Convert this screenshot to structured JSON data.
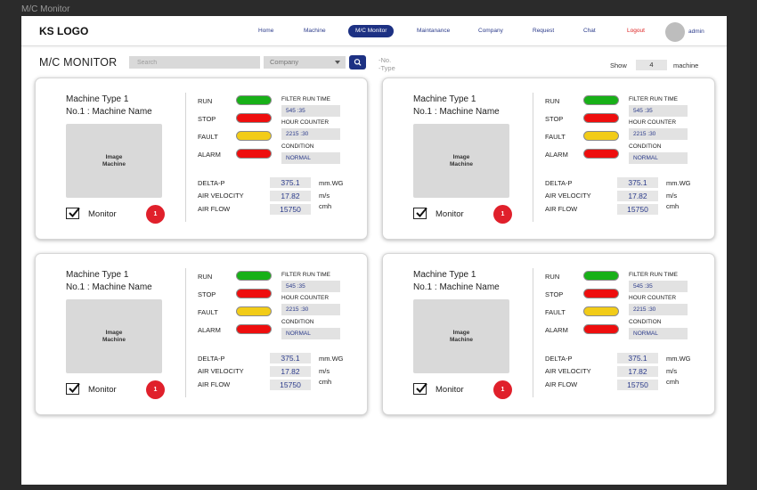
{
  "window_title": "M/C Monitor",
  "navbar": {
    "logo": "KS LOGO",
    "items": [
      {
        "label": "Home"
      },
      {
        "label": "Machine"
      },
      {
        "label": "M/C Monitor"
      },
      {
        "label": "Maintanance"
      },
      {
        "label": "Company"
      },
      {
        "label": "Request"
      },
      {
        "label": "Chat"
      },
      {
        "label": "Logout"
      }
    ],
    "user": "admin"
  },
  "toolbar": {
    "title": "M/C MONITOR",
    "search_placeholder": "Search",
    "company_select": "Company",
    "note_line1": "-No.",
    "note_line2": "-Type",
    "show_label": "Show",
    "show_count": "4",
    "show_unit": "machine"
  },
  "cards": [
    {
      "type": "Machine Type 1",
      "name": "No.1 : Machine Name",
      "image_line1": "Image",
      "image_line2": "Machine",
      "monitor_label": "Monitor",
      "monitor_checked": true,
      "alert_count": "1",
      "statuses": [
        {
          "label": "RUN",
          "color": "#18b018"
        },
        {
          "label": "STOP",
          "color": "#ee0e0e"
        },
        {
          "label": "FAULT",
          "color": "#f2cc18"
        },
        {
          "label": "ALARM",
          "color": "#ee0e0e"
        }
      ],
      "filter_run_time_label": "FILTER RUN TIME",
      "filter_run_time": "545 :35",
      "hour_counter_label": "HOUR COUNTER",
      "hour_counter": "2215 :30",
      "condition_label": "CONDITION",
      "condition": "NORMAL",
      "metrics": [
        {
          "label": "DELTA-P",
          "value": "375.1",
          "unit": "mm.WG"
        },
        {
          "label": "AIR VELOCITY",
          "value": "17.82",
          "unit": "m/s"
        },
        {
          "label": "AIR FLOW",
          "value": "15750",
          "unit": "cmh"
        }
      ]
    },
    {
      "type": "Machine Type 1",
      "name": "No.1 : Machine Name",
      "image_line1": "Image",
      "image_line2": "Machine",
      "monitor_label": "Monitor",
      "monitor_checked": true,
      "alert_count": "1",
      "statuses": [
        {
          "label": "RUN",
          "color": "#18b018"
        },
        {
          "label": "STOP",
          "color": "#ee0e0e"
        },
        {
          "label": "FAULT",
          "color": "#f2cc18"
        },
        {
          "label": "ALARM",
          "color": "#ee0e0e"
        }
      ],
      "filter_run_time_label": "FILTER RUN TIME",
      "filter_run_time": "545 :35",
      "hour_counter_label": "HOUR COUNTER",
      "hour_counter": "2215 :30",
      "condition_label": "CONDITION",
      "condition": "NORMAL",
      "metrics": [
        {
          "label": "DELTA-P",
          "value": "375.1",
          "unit": "mm.WG"
        },
        {
          "label": "AIR VELOCITY",
          "value": "17.82",
          "unit": "m/s"
        },
        {
          "label": "AIR FLOW",
          "value": "15750",
          "unit": "cmh"
        }
      ]
    },
    {
      "type": "Machine Type 1",
      "name": "No.1 : Machine Name",
      "image_line1": "Image",
      "image_line2": "Machine",
      "monitor_label": "Monitor",
      "monitor_checked": true,
      "alert_count": "1",
      "statuses": [
        {
          "label": "RUN",
          "color": "#18b018"
        },
        {
          "label": "STOP",
          "color": "#ee0e0e"
        },
        {
          "label": "FAULT",
          "color": "#f2cc18"
        },
        {
          "label": "ALARM",
          "color": "#ee0e0e"
        }
      ],
      "filter_run_time_label": "FILTER RUN TIME",
      "filter_run_time": "545 :35",
      "hour_counter_label": "HOUR COUNTER",
      "hour_counter": "2215 :30",
      "condition_label": "CONDITION",
      "condition": "NORMAL",
      "metrics": [
        {
          "label": "DELTA-P",
          "value": "375.1",
          "unit": "mm.WG"
        },
        {
          "label": "AIR VELOCITY",
          "value": "17.82",
          "unit": "m/s"
        },
        {
          "label": "AIR FLOW",
          "value": "15750",
          "unit": "cmh"
        }
      ]
    },
    {
      "type": "Machine Type 1",
      "name": "No.1 : Machine Name",
      "image_line1": "Image",
      "image_line2": "Machine",
      "monitor_label": "Monitor",
      "monitor_checked": true,
      "alert_count": "1",
      "statuses": [
        {
          "label": "RUN",
          "color": "#18b018"
        },
        {
          "label": "STOP",
          "color": "#ee0e0e"
        },
        {
          "label": "FAULT",
          "color": "#f2cc18"
        },
        {
          "label": "ALARM",
          "color": "#ee0e0e"
        }
      ],
      "filter_run_time_label": "FILTER RUN TIME",
      "filter_run_time": "545 :35",
      "hour_counter_label": "HOUR COUNTER",
      "hour_counter": "2215 :30",
      "condition_label": "CONDITION",
      "condition": "NORMAL",
      "metrics": [
        {
          "label": "DELTA-P",
          "value": "375.1",
          "unit": "mm.WG"
        },
        {
          "label": "AIR VELOCITY",
          "value": "17.82",
          "unit": "m/s"
        },
        {
          "label": "AIR FLOW",
          "value": "15750",
          "unit": "cmh"
        }
      ]
    }
  ]
}
